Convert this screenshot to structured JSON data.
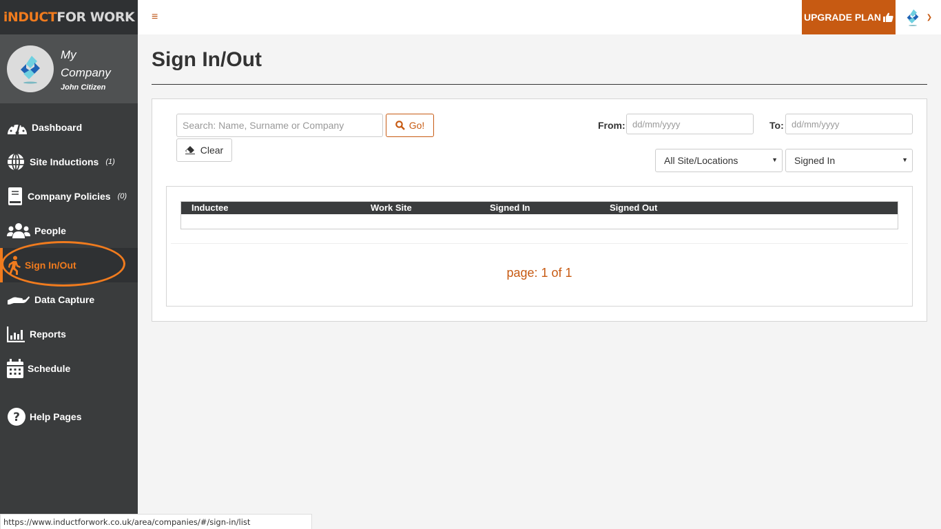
{
  "brand": {
    "part1": "iNDUCT",
    "part2": "FOR WORK"
  },
  "profile": {
    "company_line1": "My",
    "company_line2": "Company",
    "user": "John Citizen"
  },
  "sidebar": {
    "items": [
      {
        "label": "Dashboard",
        "icon": "dashboard-icon",
        "count": ""
      },
      {
        "label": "Site Inductions",
        "icon": "globe-icon",
        "count": "(1)"
      },
      {
        "label": "Company Policies",
        "icon": "book-icon",
        "count": "(0)"
      },
      {
        "label": "People",
        "icon": "users-icon",
        "count": ""
      },
      {
        "label": "Sign In/Out",
        "icon": "walking-icon",
        "count": "",
        "active": true
      },
      {
        "label": "Data Capture",
        "icon": "hand-icon",
        "count": ""
      },
      {
        "label": "Reports",
        "icon": "bar-chart-icon",
        "count": ""
      },
      {
        "label": "Schedule",
        "icon": "calendar-icon",
        "count": ""
      },
      {
        "label": "Help Pages",
        "icon": "question-icon",
        "count": ""
      }
    ]
  },
  "topbar": {
    "menu_icon": "≡",
    "upgrade_label": "UPGRADE PLAN"
  },
  "page": {
    "title": "Sign In/Out"
  },
  "filters": {
    "search_placeholder": "Search: Name, Surname or Company",
    "search_value": "",
    "go_label": "Go!",
    "clear_label": "Clear",
    "from_label": "From:",
    "from_placeholder": "dd/mm/yyyy",
    "to_label": "To:",
    "to_placeholder": "dd/mm/yyyy",
    "site_selected": "All Site/Locations",
    "status_selected": "Signed In"
  },
  "table": {
    "columns": [
      "Inductee",
      "Work Site",
      "Signed In",
      "Signed Out"
    ],
    "rows": []
  },
  "pager": {
    "text": "page: 1 of 1"
  },
  "colors": {
    "accent": "#c75a12",
    "sidebar": "#3a3c3d",
    "brand_orange": "#f07b1e"
  },
  "statusbar": {
    "url": "https://www.inductforwork.co.uk/area/companies/#/sign-in/list"
  }
}
